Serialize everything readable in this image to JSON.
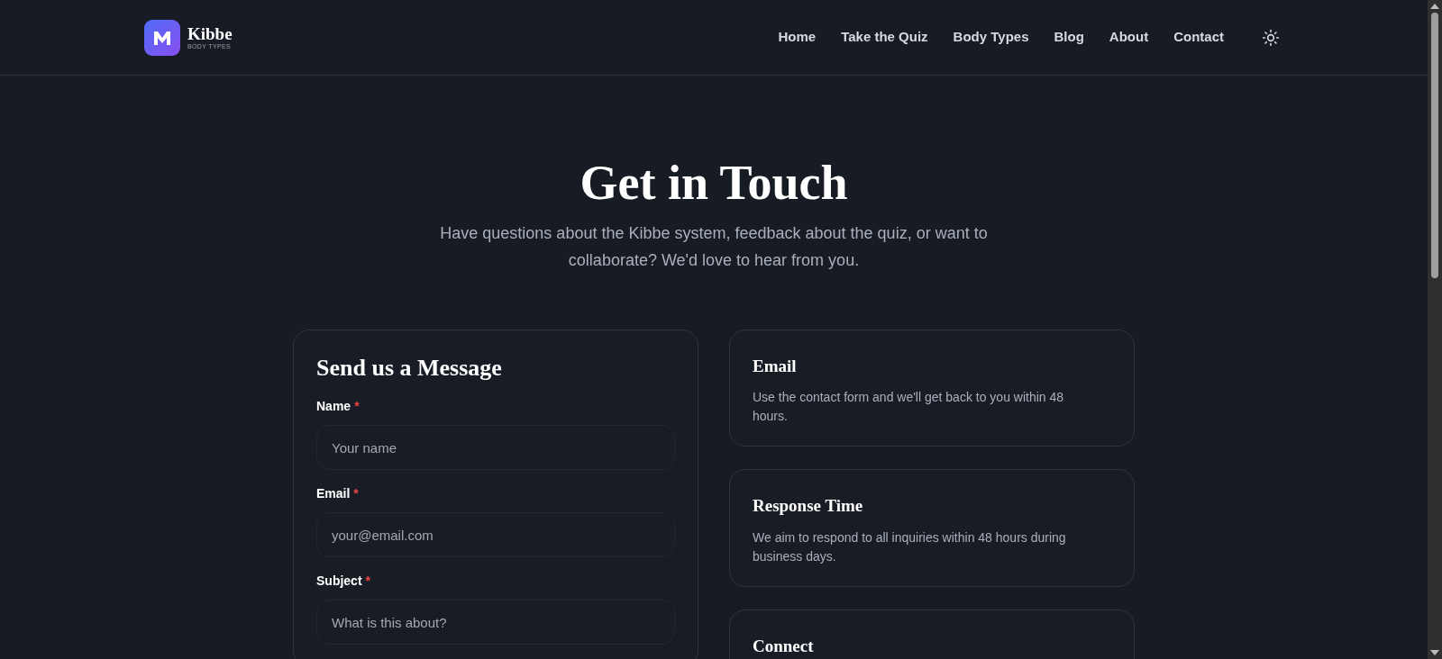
{
  "header": {
    "logo": {
      "name": "Kibbe",
      "tagline": "BODY TYPES"
    },
    "nav": [
      "Home",
      "Take the Quiz",
      "Body Types",
      "Blog",
      "About",
      "Contact"
    ]
  },
  "hero": {
    "title": "Get in Touch",
    "subtitle": "Have questions about the Kibbe system, feedback about the quiz, or want to collaborate? We'd love to hear from you."
  },
  "form": {
    "title": "Send us a Message",
    "fields": [
      {
        "label": "Name",
        "required_mark": "*",
        "placeholder": "Your name"
      },
      {
        "label": "Email",
        "required_mark": "*",
        "placeholder": "your@email.com"
      },
      {
        "label": "Subject",
        "required_mark": "*",
        "placeholder": "What is this about?"
      }
    ]
  },
  "info_cards": [
    {
      "title": "Email",
      "text": "Use the contact form and we'll get back to you within 48 hours."
    },
    {
      "title": "Response Time",
      "text": "We aim to respond to all inquiries within 48 hours during business days."
    },
    {
      "title": "Connect"
    }
  ]
}
